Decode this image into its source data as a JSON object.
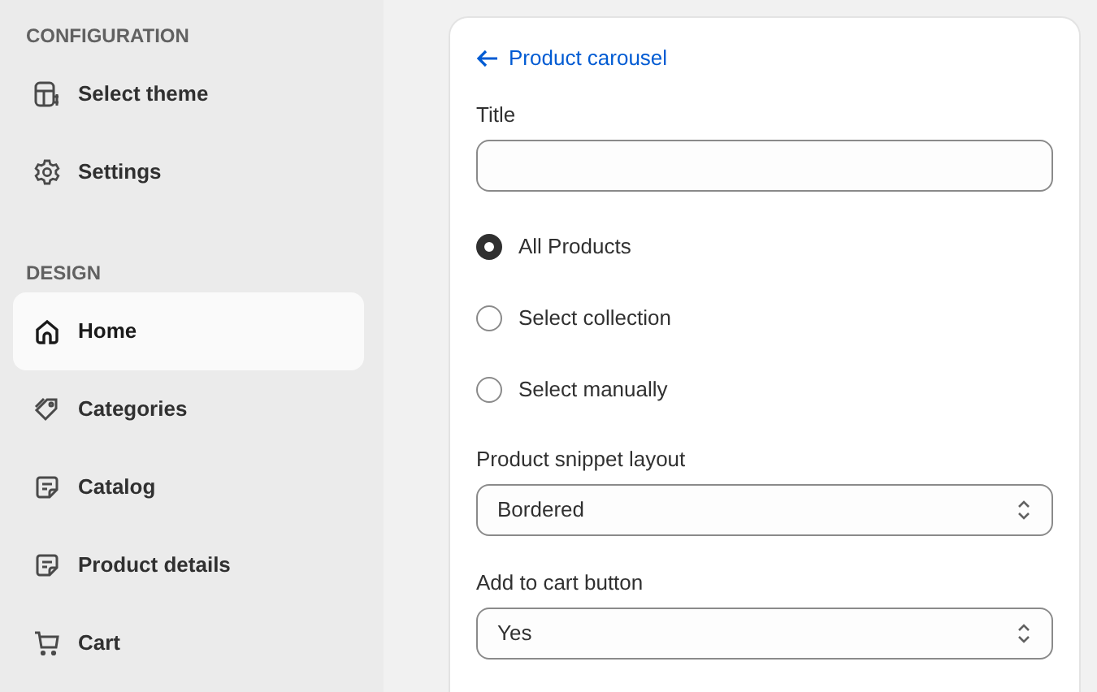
{
  "sidebar": {
    "sections": [
      {
        "heading": "CONFIGURATION",
        "items": [
          {
            "label": "Select theme",
            "selected": false
          },
          {
            "label": "Settings",
            "selected": false
          }
        ]
      },
      {
        "heading": "DESIGN",
        "items": [
          {
            "label": "Home",
            "selected": true
          },
          {
            "label": "Categories",
            "selected": false
          },
          {
            "label": "Catalog",
            "selected": false
          },
          {
            "label": "Product details",
            "selected": false
          },
          {
            "label": "Cart",
            "selected": false
          }
        ]
      }
    ]
  },
  "panel": {
    "back_link": "Product carousel",
    "title_field": {
      "label": "Title"
    },
    "radios": [
      {
        "label": "All Products",
        "selected": true
      },
      {
        "label": "Select collection",
        "selected": false
      },
      {
        "label": "Select manually",
        "selected": false
      }
    ],
    "selects": [
      {
        "label": "Product snippet layout",
        "value": "Bordered"
      },
      {
        "label": "Add to cart button",
        "value": "Yes"
      }
    ]
  }
}
